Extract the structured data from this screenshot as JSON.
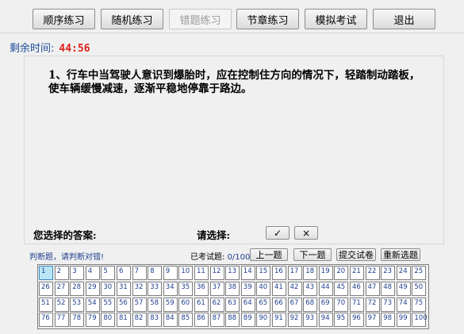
{
  "toolbar": {
    "buttons": [
      "顺序练习",
      "随机练习",
      "错题练习",
      "节章练习",
      "模拟考试",
      "退出"
    ]
  },
  "timer": {
    "label": "剩余时间:",
    "value": "44:56"
  },
  "question": {
    "text": "1、行车中当驾驶人意识到爆胎时，应在控制住方向的情况下，轻踏制动踏板，使车辆缓慢减速，逐渐平稳地停靠于路边。"
  },
  "answer": {
    "your_answer_label": "您选择的答案:",
    "choose_label": "请选择:",
    "true_symbol": "✓",
    "false_symbol": "×"
  },
  "footer": {
    "hint": "判断题，请判断对错!",
    "progress_label": "已考试题:",
    "progress_value": "0/100",
    "prev": "上一题",
    "next": "下一题",
    "submit": "提交试卷",
    "restart": "重新选题"
  },
  "grid": {
    "current": 1,
    "count": 100
  }
}
